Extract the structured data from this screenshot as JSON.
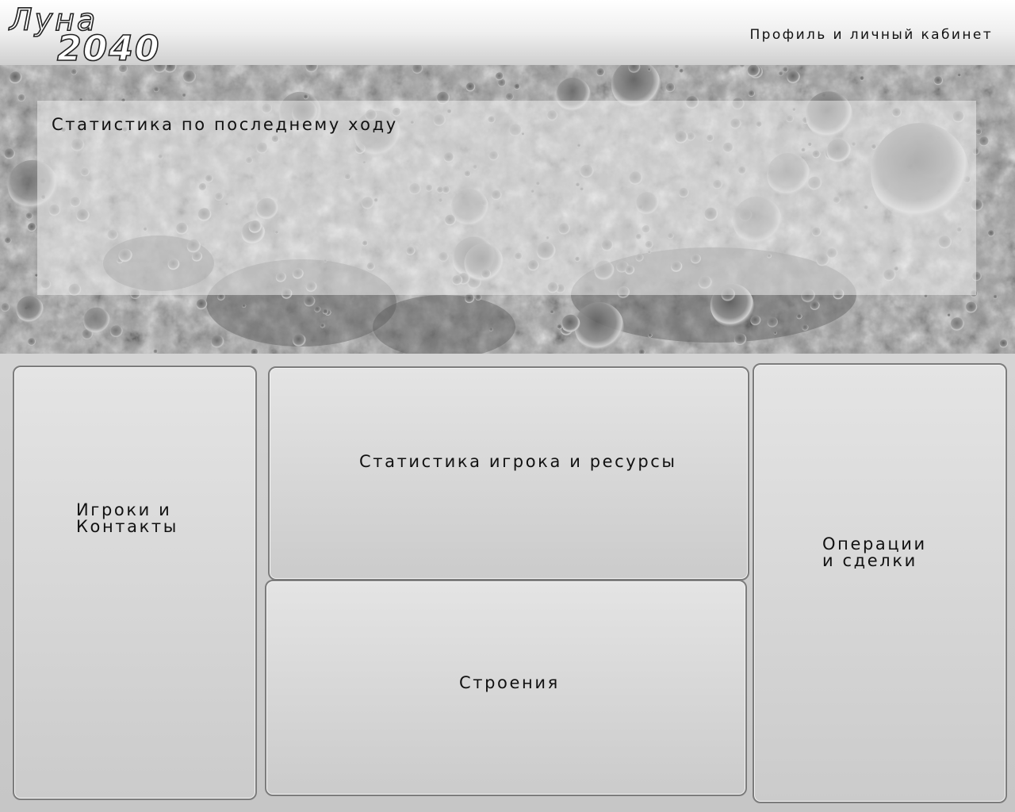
{
  "header": {
    "logo": {
      "word": "Луна",
      "year": "2040"
    },
    "profile_link": "Профиль и личный кабинет"
  },
  "banner": {
    "image": "moon-surface",
    "stats_title": "Статистика по последнему ходу"
  },
  "panels": {
    "players": {
      "line1": "Игроки и",
      "line2": "Контакты"
    },
    "player_stats": {
      "label": "Статистика игрока и ресурсы"
    },
    "buildings": {
      "label": "Строения"
    },
    "operations": {
      "line1": "Операции",
      "line2": "и сделки"
    }
  },
  "colors": {
    "panel_border": "#7c7c7c",
    "panel_fill_top": "#e4e4e4",
    "panel_fill_bottom": "#cbcbcb",
    "text": "#111111"
  }
}
